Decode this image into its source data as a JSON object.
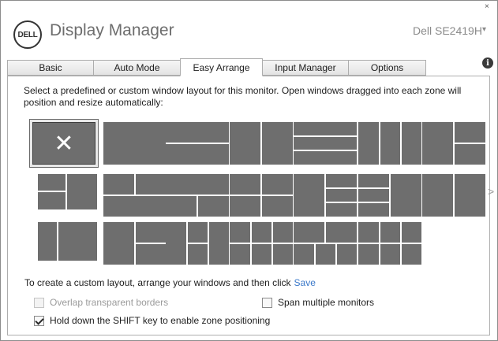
{
  "window": {
    "close_glyph": "×",
    "logo_text": "DELL",
    "app_title": "Display Manager",
    "monitor_name": "Dell SE2419H",
    "monitor_caret": "▾"
  },
  "tabs": [
    {
      "label": "Basic",
      "active": false
    },
    {
      "label": "Auto Mode",
      "active": false
    },
    {
      "label": "Easy Arrange",
      "active": true
    },
    {
      "label": "Input Manager",
      "active": false
    },
    {
      "label": "Options",
      "active": false
    }
  ],
  "info_icon": "i",
  "description": "Select a predefined or custom window layout for this monitor.  Open windows dragged into each zone will position and resize automatically:",
  "layouts": {
    "selected_index": 0,
    "selected_glyph": "✕",
    "count": 20,
    "more_arrow": ">"
  },
  "custom_prompt": "To create a custom layout, arrange your windows and then click",
  "save_link": "Save",
  "options": {
    "overlap": {
      "label": "Overlap transparent borders",
      "checked": false,
      "disabled": true
    },
    "span": {
      "label": "Span multiple monitors",
      "checked": false,
      "disabled": false
    },
    "shift": {
      "label": "Hold down the SHIFT key to enable zone positioning",
      "checked": true,
      "disabled": false
    }
  },
  "colors": {
    "zone_fill": "#6e6e6e",
    "link": "#3a78c9"
  }
}
